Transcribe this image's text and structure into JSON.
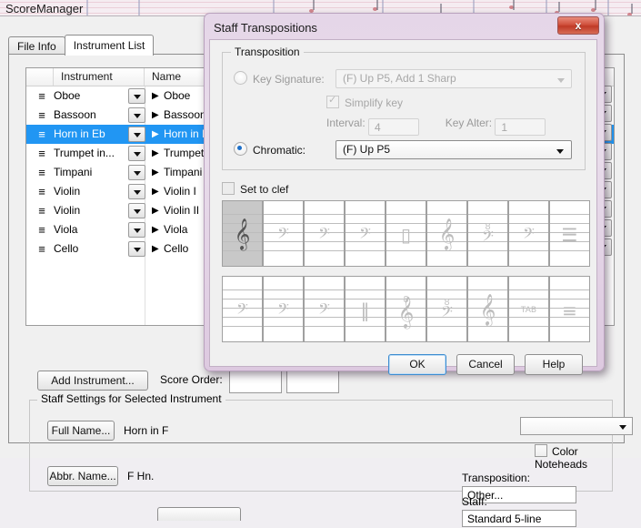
{
  "app": {
    "title": "ScoreManager",
    "tabs": [
      {
        "label": "File Info",
        "active": false
      },
      {
        "label": "Instrument List",
        "active": true
      }
    ]
  },
  "instrument_grid": {
    "columns": [
      "",
      "Instrument",
      "Name"
    ],
    "rows": [
      {
        "handle": "≡",
        "instrument": "Oboe",
        "arrow": "▶",
        "name": "Oboe",
        "selected": false
      },
      {
        "handle": "≡",
        "instrument": "Bassoon",
        "arrow": "▶",
        "name": "Bassoon",
        "selected": false
      },
      {
        "handle": "≡",
        "instrument": "Horn in Eb",
        "arrow": "▶",
        "name": "Horn in F",
        "selected": true
      },
      {
        "handle": "≡",
        "instrument": "Trumpet in...",
        "arrow": "▶",
        "name": "Trumpet in B",
        "selected": false
      },
      {
        "handle": "≡",
        "instrument": "Timpani",
        "arrow": "▶",
        "name": "Timpani",
        "selected": false
      },
      {
        "handle": "≡",
        "instrument": "Violin",
        "arrow": "▶",
        "name": "Violin I",
        "selected": false
      },
      {
        "handle": "≡",
        "instrument": "Violin",
        "arrow": "▶",
        "name": "Violin II",
        "selected": false
      },
      {
        "handle": "≡",
        "instrument": "Viola",
        "arrow": "▶",
        "name": "Viola",
        "selected": false
      },
      {
        "handle": "≡",
        "instrument": "Cello",
        "arrow": "▶",
        "name": "Cello",
        "selected": false
      }
    ]
  },
  "main_controls": {
    "add_instrument_label": "Add Instrument...",
    "score_order_label": "Score Order:",
    "staff_settings_title": "Staff Settings for Selected Instrument",
    "full_name_button": "Full Name...",
    "full_name_value": "Horn in F",
    "abbr_name_button": "Abbr. Name...",
    "abbr_name_value": "F Hn.",
    "color_noteheads_label": "Color Noteheads",
    "color_noteheads_checked": false,
    "transposition_label": "Transposition:",
    "transposition_value": "Other...",
    "staff_label": "Staff:",
    "staff_value": "Standard 5-line"
  },
  "dialog": {
    "title": "Staff Transpositions",
    "close_glyph": "x",
    "group_title": "Transposition",
    "key_signature": {
      "label": "Key Signature:",
      "selected": false,
      "value": "(F) Up P5, Add 1 Sharp",
      "enabled": false
    },
    "simplify_key": {
      "label": "Simplify key",
      "checked": true,
      "enabled": false
    },
    "interval": {
      "label": "Interval:",
      "value": "4"
    },
    "key_alter": {
      "label": "Key Alter:",
      "value": "1"
    },
    "chromatic": {
      "label": "Chromatic:",
      "selected": true,
      "value": "(F) Up P5"
    },
    "set_to_clef": {
      "label": "Set to clef",
      "checked": false
    },
    "clef_grid": {
      "selected_index": 0,
      "rows": [
        [
          {
            "name": "treble-clef",
            "glyph": "𝄞",
            "size": "lg",
            "octave": ""
          },
          {
            "name": "alto-clef",
            "glyph": "𝄢",
            "size": "sm",
            "octave": ""
          },
          {
            "name": "tenor-clef",
            "glyph": "𝄢",
            "size": "sm",
            "octave": ""
          },
          {
            "name": "bass-clef",
            "glyph": "𝄢",
            "size": "sm",
            "octave": ""
          },
          {
            "name": "percussion-clef",
            "glyph": "▯",
            "size": "sm",
            "octave": ""
          },
          {
            "name": "treble-clef-8vb",
            "glyph": "𝄞",
            "size": "lg",
            "octave": ""
          },
          {
            "name": "bass-clef-8vb",
            "glyph": "𝄢",
            "size": "sm",
            "octave": "8"
          },
          {
            "name": "bass-clef-alt",
            "glyph": "𝄢",
            "size": "sm",
            "octave": ""
          },
          {
            "name": "tab-staff-clef",
            "glyph": "☰",
            "size": "sm",
            "octave": ""
          }
        ],
        [
          {
            "name": "alto-clef-line1",
            "glyph": "𝄢",
            "size": "sm",
            "octave": ""
          },
          {
            "name": "alto-clef-line3",
            "glyph": "𝄢",
            "size": "sm",
            "octave": ""
          },
          {
            "name": "alto-clef-line4",
            "glyph": "𝄢",
            "size": "sm",
            "octave": ""
          },
          {
            "name": "percussion-clef-2line",
            "glyph": "‖",
            "size": "sm",
            "octave": ""
          },
          {
            "name": "treble-clef-8va",
            "glyph": "𝄞",
            "size": "lg",
            "octave": "8"
          },
          {
            "name": "bass-clef-8va",
            "glyph": "𝄢",
            "size": "sm",
            "octave": "8"
          },
          {
            "name": "treble-clef-plain",
            "glyph": "𝄞",
            "size": "lg",
            "octave": ""
          },
          {
            "name": "tab-clef",
            "glyph": "TAB",
            "size": "tab",
            "octave": ""
          },
          {
            "name": "blank-clef",
            "glyph": "≡",
            "size": "sm",
            "octave": ""
          }
        ]
      ]
    },
    "buttons": [
      {
        "label": "OK",
        "default": true
      },
      {
        "label": "Cancel",
        "default": false
      },
      {
        "label": "Help",
        "default": false
      }
    ]
  }
}
